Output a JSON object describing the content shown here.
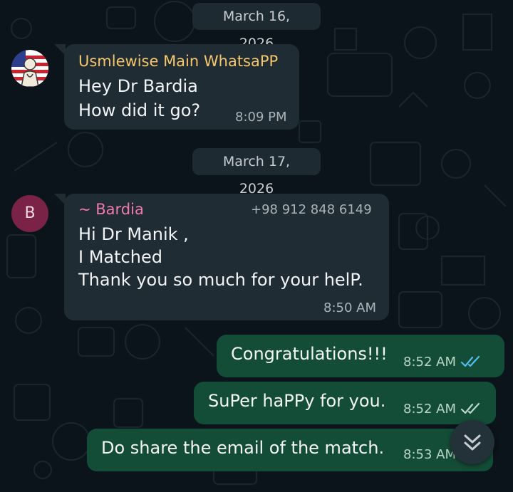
{
  "dates": {
    "first": "March 16, 2026",
    "second": "March 17, 2026"
  },
  "colors": {
    "chat_background": "#0b141a",
    "incoming_bubble": "#1f2c33",
    "outgoing_bubble": "#144d37",
    "group_sender_color": "#f6c66c",
    "bardia_sender_color": "#f07ab0",
    "read_ticks": "#53bdeb",
    "delivered_ticks": "#b9d6c8"
  },
  "messages": [
    {
      "direction": "incoming",
      "sender": "Usmlewise Main WhatsaPP",
      "avatar_icon": "us-flag-doctor-avatar-icon",
      "lines": [
        "Hey Dr Bardia",
        "How did it go?"
      ],
      "time": "8:09 PM"
    },
    {
      "direction": "incoming",
      "sender": "~ Bardia",
      "avatar_letter": "B",
      "phone": "+98 912 848 6149",
      "lines": [
        "Hi Dr Manik ,",
        "I Matched",
        "Thank you so much for your helP."
      ],
      "time": "8:50 AM"
    },
    {
      "direction": "outgoing",
      "text": "Congratulations!!!",
      "time": "8:52 AM",
      "status_icon": "double-tick-read-icon"
    },
    {
      "direction": "outgoing",
      "text": "SuPer haPPy for you.",
      "time": "8:52 AM",
      "status_icon": "double-tick-delivered-icon"
    },
    {
      "direction": "outgoing",
      "text": "Do share the email of the match.",
      "time": "8:53 AM"
    }
  ],
  "controls": {
    "scroll_button_icon": "double-chevron-down-icon"
  }
}
